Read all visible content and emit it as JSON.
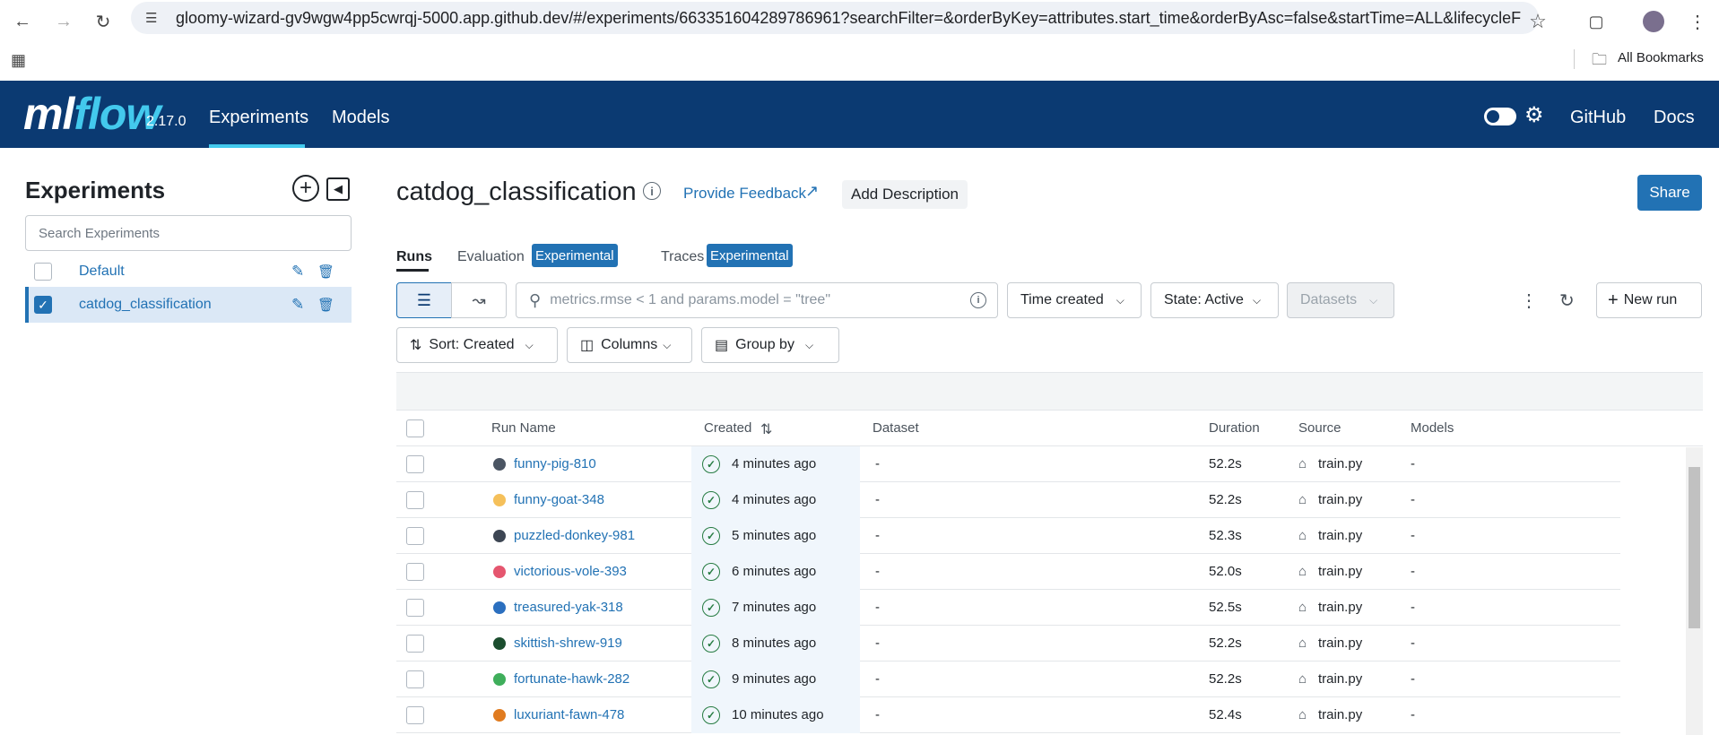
{
  "browser": {
    "url": "gloomy-wizard-gv9wgw4pp5cwrqj-5000.app.github.dev/#/experiments/663351604289786961?searchFilter=&orderByKey=attributes.start_time&orderByAsc=false&startTime=ALL&lifecycleFilt...",
    "bookmarks_label": "All Bookmarks"
  },
  "nav": {
    "logo_ml": "ml",
    "logo_flow": "flow",
    "version": "2.17.0",
    "links": [
      "Experiments",
      "Models"
    ],
    "right_links": [
      "GitHub",
      "Docs"
    ]
  },
  "sidebar": {
    "title": "Experiments",
    "search_placeholder": "Search Experiments",
    "experiments": [
      {
        "name": "Default",
        "selected": false
      },
      {
        "name": "catdog_classification",
        "selected": true
      }
    ]
  },
  "main": {
    "experiment_title": "catdog_classification",
    "feedback_label": "Provide Feedback",
    "add_description_label": "Add Description",
    "share_label": "Share",
    "tabs": [
      "Runs",
      "Evaluation",
      "Traces"
    ],
    "badge_label": "Experimental",
    "filter_placeholder": "metrics.rmse < 1 and params.model = \"tree\"",
    "time_created_label": "Time created",
    "state_label": "State: Active",
    "datasets_label": "Datasets",
    "new_run_label": "New run",
    "sort_label": "Sort: Created",
    "columns_label": "Columns",
    "group_by_label": "Group by"
  },
  "table": {
    "columns": [
      "Run Name",
      "Created",
      "Dataset",
      "Duration",
      "Source",
      "Models"
    ],
    "rows": [
      {
        "name": "funny-pig-810",
        "color": "#4b5563",
        "created": "4 minutes ago",
        "dataset": "-",
        "duration": "52.2s",
        "source": "train.py",
        "models": "-"
      },
      {
        "name": "funny-goat-348",
        "color": "#f5c05a",
        "created": "4 minutes ago",
        "dataset": "-",
        "duration": "52.2s",
        "source": "train.py",
        "models": "-"
      },
      {
        "name": "puzzled-donkey-981",
        "color": "#3d4653",
        "created": "5 minutes ago",
        "dataset": "-",
        "duration": "52.3s",
        "source": "train.py",
        "models": "-"
      },
      {
        "name": "victorious-vole-393",
        "color": "#e5566f",
        "created": "6 minutes ago",
        "dataset": "-",
        "duration": "52.0s",
        "source": "train.py",
        "models": "-"
      },
      {
        "name": "treasured-yak-318",
        "color": "#2b6fbf",
        "created": "7 minutes ago",
        "dataset": "-",
        "duration": "52.5s",
        "source": "train.py",
        "models": "-"
      },
      {
        "name": "skittish-shrew-919",
        "color": "#1b4d2e",
        "created": "8 minutes ago",
        "dataset": "-",
        "duration": "52.2s",
        "source": "train.py",
        "models": "-"
      },
      {
        "name": "fortunate-hawk-282",
        "color": "#3fae5b",
        "created": "9 minutes ago",
        "dataset": "-",
        "duration": "52.2s",
        "source": "train.py",
        "models": "-"
      },
      {
        "name": "luxuriant-fawn-478",
        "color": "#e07b1f",
        "created": "10 minutes ago",
        "dataset": "-",
        "duration": "52.4s",
        "source": "train.py",
        "models": "-"
      }
    ]
  }
}
